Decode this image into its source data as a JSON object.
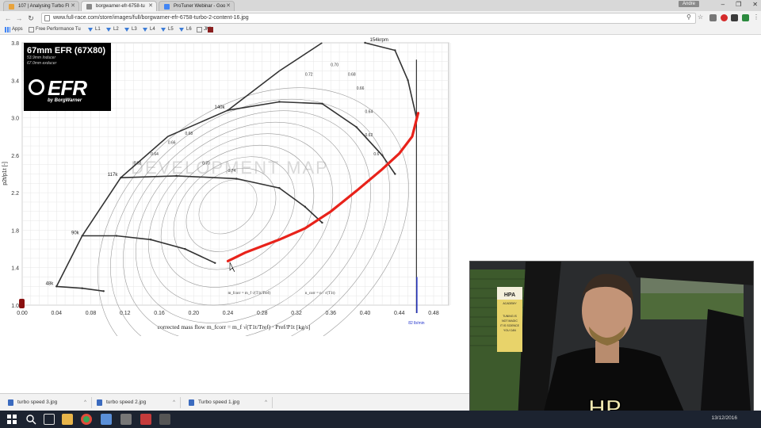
{
  "browser": {
    "tabs": [
      {
        "label": "107 | Analysing Turbo Fl",
        "color": "#e8a33c",
        "active": false
      },
      {
        "label": "borgwarner-efr-6758-tu",
        "color": "#888888",
        "active": true
      },
      {
        "label": "ProTuner Webinar - Goo",
        "color": "#4285f4",
        "active": false
      }
    ],
    "user_name": "Andre",
    "url": "www.full-race.com/store/images/full/borgwarner-efr-6758-turbo-2-content-16.jpg",
    "window_controls": [
      "–",
      "❐",
      "✕"
    ],
    "bookmarks": [
      {
        "label": "Apps",
        "icon": "apps-grid-icon"
      },
      {
        "label": "Free Performance Tu",
        "icon": "page-icon"
      },
      {
        "label": "L1",
        "icon": "download-arrow-icon"
      },
      {
        "label": "L2",
        "icon": "download-arrow-icon"
      },
      {
        "label": "L3",
        "icon": "download-arrow-icon"
      },
      {
        "label": "L4",
        "icon": "download-arrow-icon"
      },
      {
        "label": "L5",
        "icon": "download-arrow-icon"
      },
      {
        "label": "L6",
        "icon": "download-arrow-icon"
      },
      {
        "label": "JML",
        "icon": "page-icon"
      }
    ]
  },
  "map_brand": {
    "title": "67mm EFR  (67X80)",
    "inducer": "53.9mm Inducer",
    "exducer": "67.0mm exducer",
    "logo": "EFR",
    "byline": "by BorgWarner"
  },
  "chart_data": {
    "type": "line",
    "title": "",
    "xlabel": "corrected mass flow   m_fcorr = m_f √(T1t/Tref) · Pref/P1t   [kg/s]",
    "ylabel": "p2t/p1t [-]",
    "xlim": [
      0.0,
      0.5
    ],
    "ylim": [
      1.0,
      3.8
    ],
    "x_ticks": [
      "0.00",
      "0.04",
      "0.08",
      "0.12",
      "0.16",
      "0.20",
      "0.24",
      "0.28",
      "0.32",
      "0.36",
      "0.40",
      "0.44",
      "0.48"
    ],
    "y_ticks": [
      "1.0",
      "1.4",
      "1.8",
      "2.2",
      "2.6",
      "3.0",
      "3.4",
      "3.8"
    ],
    "watermark": "DEVELOPMENT MAP",
    "formula_1": "m_fcorr = m_f √(T1t/Tref)",
    "formula_2": "n_corr = n / √(T1t)",
    "choke_label": "82 lb/min",
    "speed_lines": [
      {
        "label": "48k",
        "points": [
          [
            0.04,
            1.2
          ],
          [
            0.07,
            1.18
          ],
          [
            0.095,
            1.15
          ]
        ]
      },
      {
        "label": "90k",
        "points": [
          [
            0.07,
            1.74
          ],
          [
            0.11,
            1.74
          ],
          [
            0.15,
            1.7
          ],
          [
            0.19,
            1.6
          ],
          [
            0.225,
            1.45
          ]
        ]
      },
      {
        "label": "117k",
        "points": [
          [
            0.115,
            2.36
          ],
          [
            0.18,
            2.38
          ],
          [
            0.25,
            2.35
          ],
          [
            0.3,
            2.25
          ],
          [
            0.33,
            2.05
          ],
          [
            0.35,
            1.88
          ]
        ]
      },
      {
        "label": "140k",
        "points": [
          [
            0.24,
            3.08
          ],
          [
            0.3,
            3.17
          ],
          [
            0.35,
            3.15
          ],
          [
            0.39,
            2.9
          ],
          [
            0.42,
            2.6
          ],
          [
            0.435,
            2.4
          ]
        ]
      },
      {
        "label": "154krpm",
        "points": [
          [
            0.4,
            3.8
          ],
          [
            0.435,
            3.72
          ],
          [
            0.45,
            3.4
          ],
          [
            0.46,
            3.0
          ]
        ]
      }
    ],
    "surge_line": [
      [
        0.04,
        1.2
      ],
      [
        0.07,
        1.74
      ],
      [
        0.115,
        2.36
      ],
      [
        0.17,
        2.8
      ],
      [
        0.24,
        3.08
      ],
      [
        0.3,
        3.5
      ],
      [
        0.35,
        3.8
      ]
    ],
    "efficiency_labels": [
      "0.62",
      "0.64",
      "0.66",
      "0.68",
      "0.70",
      "0.72",
      "0.74",
      "0.70",
      "0.68",
      "0.66",
      "0.64",
      "0.62",
      "0.6"
    ],
    "red_trace": [
      [
        0.24,
        1.47
      ],
      [
        0.26,
        1.56
      ],
      [
        0.3,
        1.7
      ],
      [
        0.33,
        1.82
      ],
      [
        0.36,
        2.0
      ],
      [
        0.39,
        2.22
      ],
      [
        0.42,
        2.45
      ],
      [
        0.44,
        2.62
      ],
      [
        0.455,
        2.8
      ],
      [
        0.462,
        3.05
      ]
    ],
    "grid": true,
    "legend": "none"
  },
  "downloads": [
    {
      "name": "turbo speed 3.jpg"
    },
    {
      "name": "turbo speed 2.jpg"
    },
    {
      "name": "Turbo speed 1.jpg"
    }
  ],
  "taskbar": {
    "clock": "13/12/2016"
  },
  "webcam": {
    "sign_top": "HPA",
    "sign_academy": "ACADEMY",
    "sign_line1": "TUNING IS",
    "sign_line2": "NOT MAGIC",
    "sign_line3": "IT IS SCIENCE",
    "sign_line4": "YOU CAN",
    "shirt_text": "HP"
  }
}
